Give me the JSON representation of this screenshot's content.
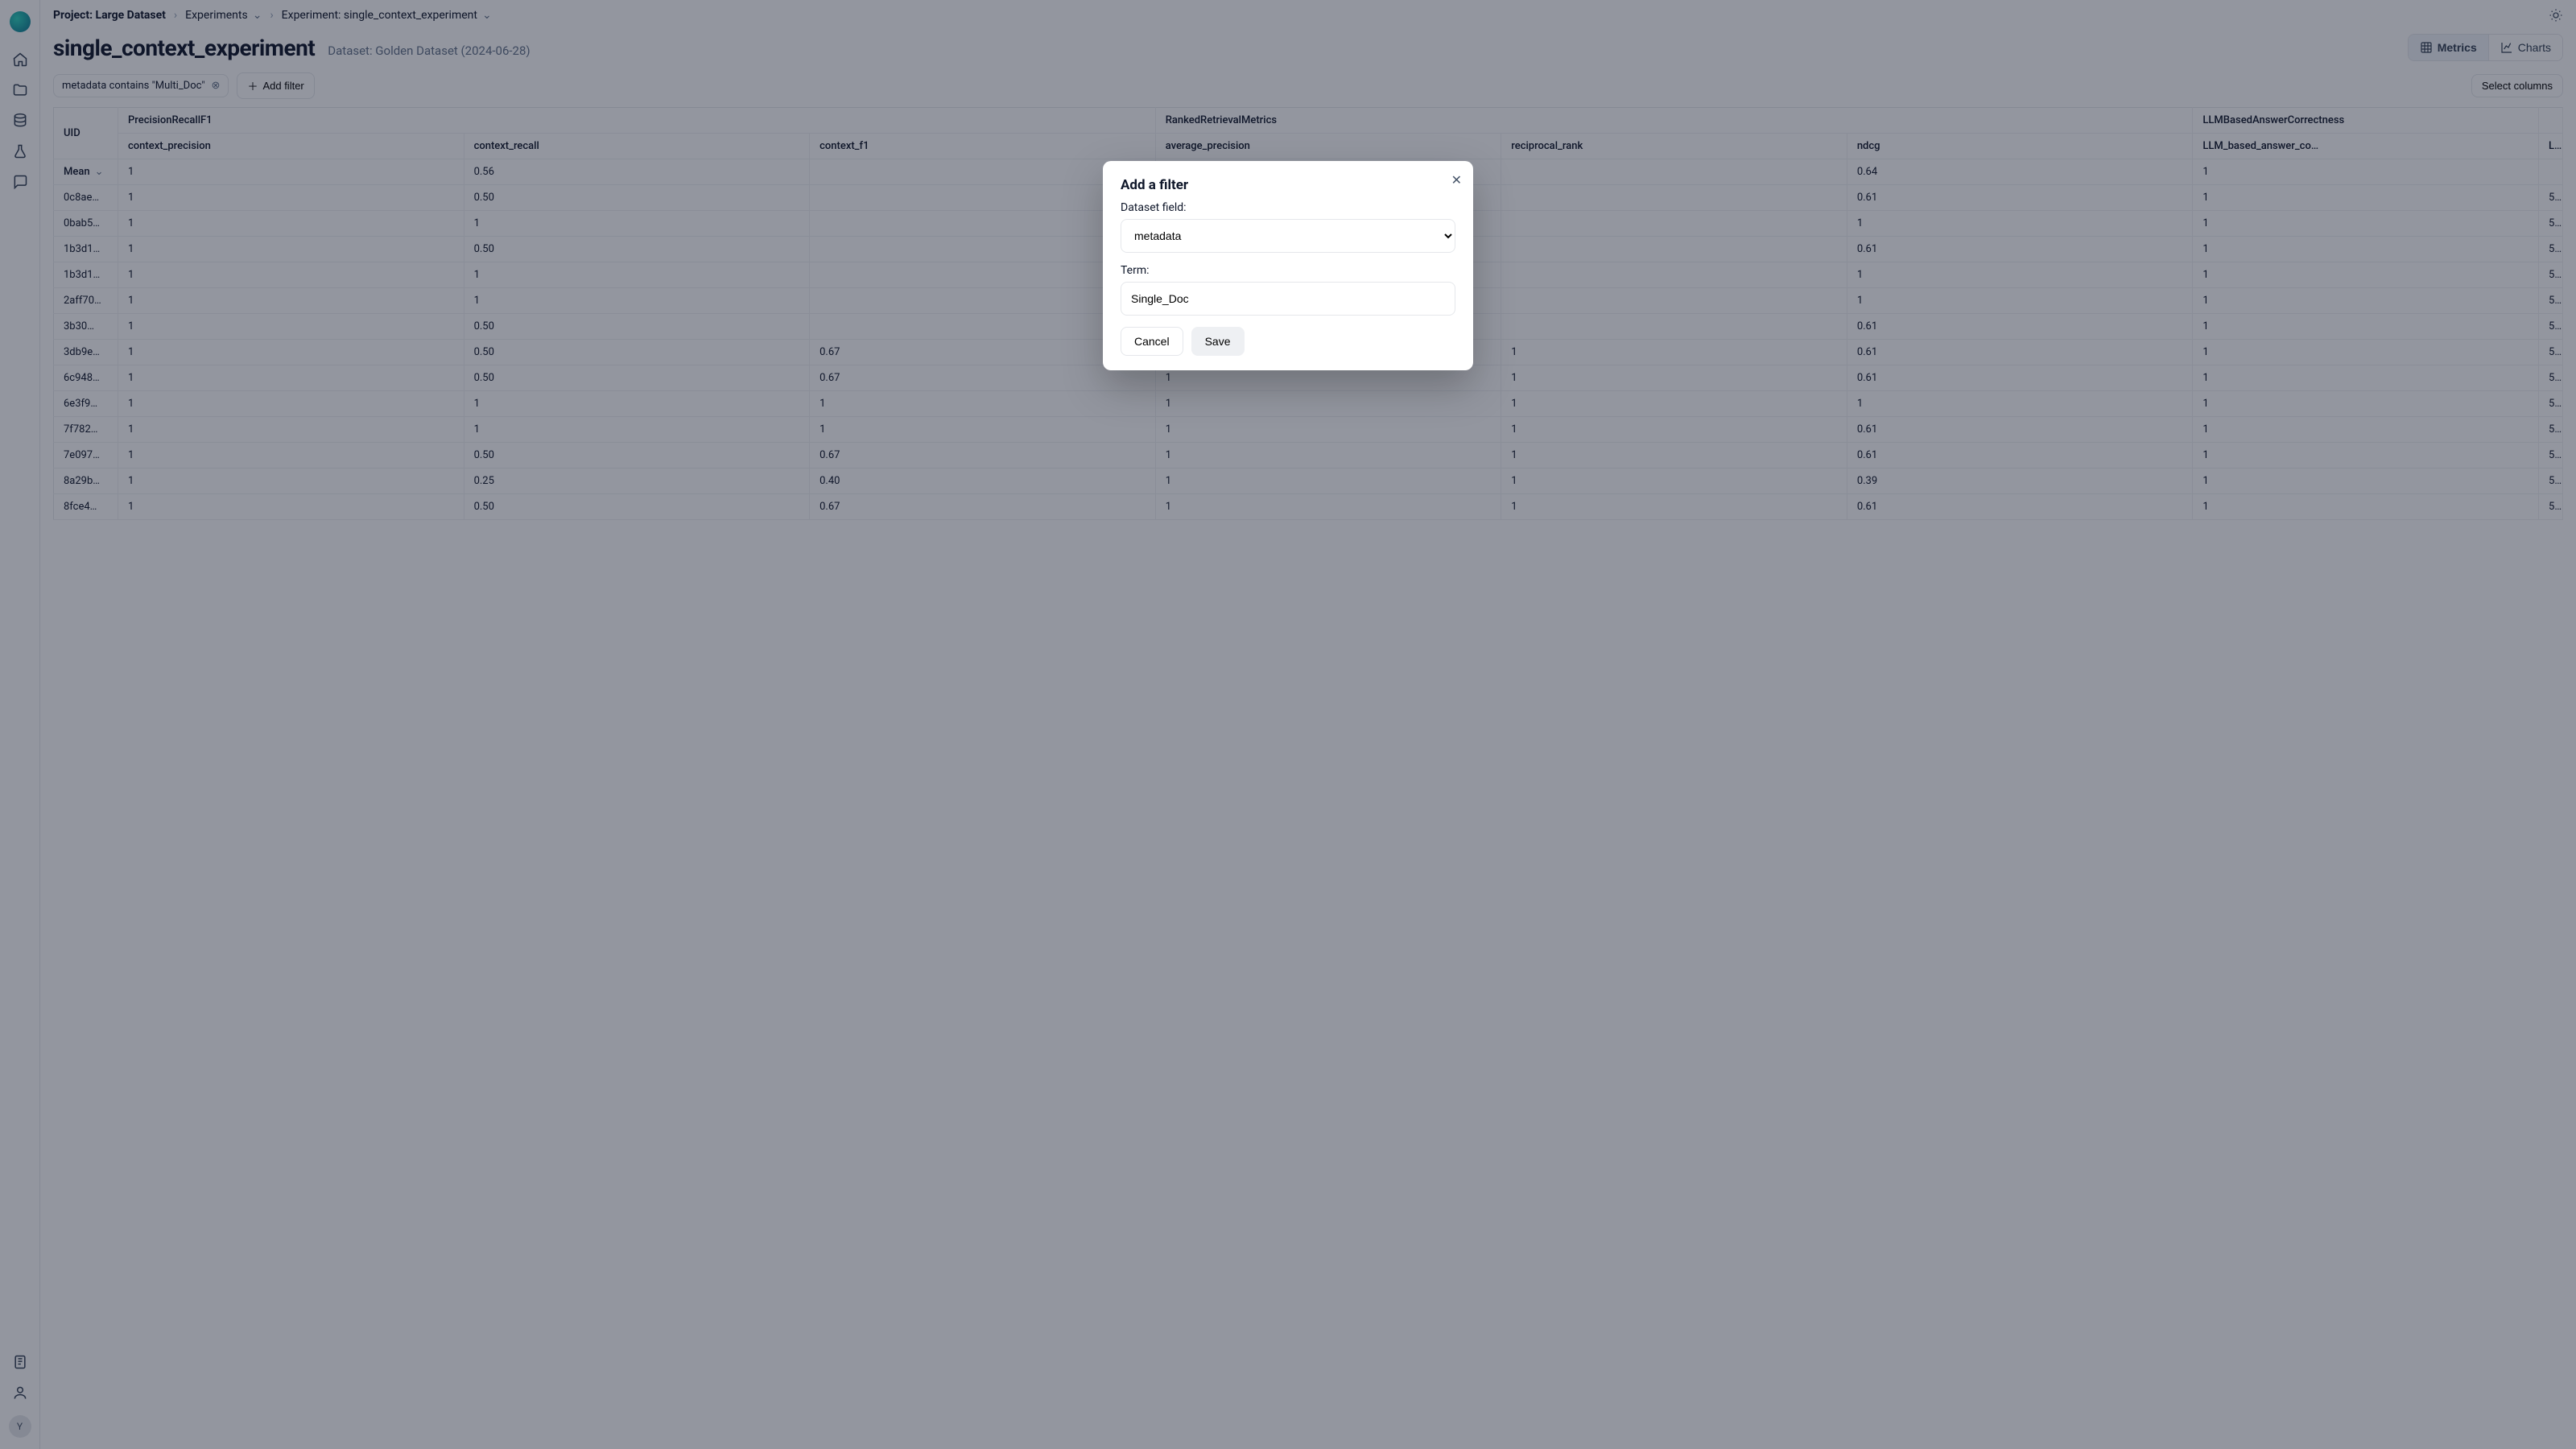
{
  "breadcrumb": {
    "project": "Project: Large Dataset",
    "experiments": "Experiments",
    "experiment": "Experiment: single_context_experiment"
  },
  "header": {
    "title": "single_context_experiment",
    "dataset": "Dataset: Golden Dataset (2024-06-28)",
    "metrics_btn": "Metrics",
    "charts_btn": "Charts"
  },
  "filters": {
    "chip_text": "metadata contains \"Multi_Doc\"",
    "add_filter": "Add filter",
    "select_columns": "Select columns"
  },
  "table": {
    "uid_header": "UID",
    "groups": [
      "PrecisionRecallF1",
      "RankedRetrievalMetrics",
      "LLMBasedAnswerCorrectness",
      ""
    ],
    "cols": [
      "context_precision",
      "context_recall",
      "context_f1",
      "average_precision",
      "reciprocal_rank",
      "ndcg",
      "LLM_based_answer_co…",
      "L"
    ],
    "mean_label": "Mean",
    "mean_row": [
      "1",
      "0.56",
      "",
      "",
      "",
      "0.64",
      "1",
      ""
    ],
    "rows": [
      {
        "uid": "0c8ae…",
        "vals": [
          "1",
          "0.50",
          "",
          "",
          "",
          "0.61",
          "1",
          "5"
        ]
      },
      {
        "uid": "0bab5…",
        "vals": [
          "1",
          "1",
          "",
          "",
          "",
          "1",
          "1",
          "5"
        ]
      },
      {
        "uid": "1b3d1…",
        "vals": [
          "1",
          "0.50",
          "",
          "",
          "",
          "0.61",
          "1",
          "5"
        ]
      },
      {
        "uid": "1b3d1…",
        "vals": [
          "1",
          "1",
          "",
          "",
          "",
          "1",
          "1",
          "5"
        ]
      },
      {
        "uid": "2aff70…",
        "vals": [
          "1",
          "1",
          "",
          "",
          "",
          "1",
          "1",
          "5"
        ]
      },
      {
        "uid": "3b30…",
        "vals": [
          "1",
          "0.50",
          "",
          "",
          "",
          "0.61",
          "1",
          "5"
        ]
      },
      {
        "uid": "3db9e…",
        "vals": [
          "1",
          "0.50",
          "0.67",
          "1",
          "1",
          "0.61",
          "1",
          "5"
        ]
      },
      {
        "uid": "6c948…",
        "vals": [
          "1",
          "0.50",
          "0.67",
          "1",
          "1",
          "0.61",
          "1",
          "5"
        ]
      },
      {
        "uid": "6e3f9…",
        "vals": [
          "1",
          "1",
          "1",
          "1",
          "1",
          "1",
          "1",
          "5"
        ]
      },
      {
        "uid": "7f782…",
        "vals": [
          "1",
          "1",
          "1",
          "1",
          "1",
          "0.61",
          "1",
          "5"
        ]
      },
      {
        "uid": "7e097…",
        "vals": [
          "1",
          "0.50",
          "0.67",
          "1",
          "1",
          "0.61",
          "1",
          "5"
        ]
      },
      {
        "uid": "8a29b…",
        "vals": [
          "1",
          "0.25",
          "0.40",
          "1",
          "1",
          "0.39",
          "1",
          "5"
        ]
      },
      {
        "uid": "8fce4…",
        "vals": [
          "1",
          "0.50",
          "0.67",
          "1",
          "1",
          "0.61",
          "1",
          "5"
        ]
      }
    ]
  },
  "modal": {
    "title": "Add a filter",
    "field_label": "Dataset field:",
    "field_value": "metadata",
    "term_label": "Term:",
    "term_value": "Single_Doc",
    "cancel": "Cancel",
    "save": "Save"
  },
  "sidebar": {
    "avatar": "Y"
  }
}
